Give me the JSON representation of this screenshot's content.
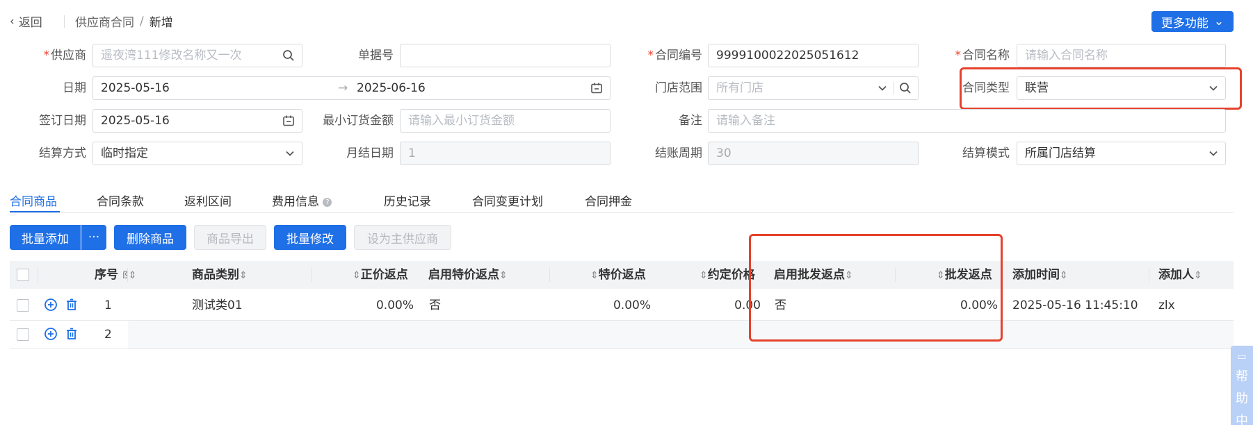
{
  "header": {
    "back_label": "返回",
    "breadcrumb_parent": "供应商合同",
    "breadcrumb_sep": "/",
    "breadcrumb_current": "新增",
    "more_button": "更多功能"
  },
  "form": {
    "supplier": {
      "label": "供应商",
      "value": "遥夜湾111修改名称又一次"
    },
    "doc_no": {
      "label": "单据号",
      "value": ""
    },
    "contract_no": {
      "label": "合同编号",
      "value": "9999100022025051612"
    },
    "contract_name": {
      "label": "合同名称",
      "placeholder": "请输入合同名称"
    },
    "date": {
      "label": "日期",
      "start": "2025-05-16",
      "arrow": "→",
      "end": "2025-06-16"
    },
    "store_scope": {
      "label": "门店范围",
      "placeholder": "所有门店"
    },
    "contract_type": {
      "label": "合同类型",
      "value": "联营"
    },
    "sign_date": {
      "label": "签订日期",
      "value": "2025-05-16"
    },
    "min_order": {
      "label": "最小订货金额",
      "placeholder": "请输入最小订货金额"
    },
    "remark": {
      "label": "备注",
      "placeholder": "请输入备注"
    },
    "settle_method": {
      "label": "结算方式",
      "value": "临时指定"
    },
    "monthly_day": {
      "label": "月结日期",
      "value": "1"
    },
    "billing_cycle": {
      "label": "结账周期",
      "value": "30"
    },
    "settle_mode": {
      "label": "结算模式",
      "value": "所属门店结算"
    }
  },
  "tabs": [
    {
      "label": "合同商品"
    },
    {
      "label": "合同条款"
    },
    {
      "label": "返利区间"
    },
    {
      "label": "费用信息"
    },
    {
      "label": "历史记录"
    },
    {
      "label": "合同变更计划"
    },
    {
      "label": "合同押金"
    }
  ],
  "toolbar": {
    "batch_add": "批量添加",
    "batch_add_more": "···",
    "delete_goods": "删除商品",
    "export_goods": "商品导出",
    "batch_edit": "批量修改",
    "set_main_supplier": "设为主供应商"
  },
  "table": {
    "headers": {
      "seq": "序号",
      "category": "商品类别",
      "normal_rebate": "正价返点",
      "enable_special": "启用特价返点",
      "special_rebate": "特价返点",
      "agreed_price": "约定价格",
      "enable_wholesale": "启用批发返点",
      "wholesale_rebate": "批发返点",
      "add_time": "添加时间",
      "adder": "添加人"
    },
    "rows": [
      {
        "seq": "1",
        "category": "测试类01",
        "normal_rebate": "0.00%",
        "enable_special": "否",
        "special_rebate": "0.00%",
        "agreed_price": "0.00",
        "enable_wholesale": "否",
        "wholesale_rebate": "0.00%",
        "add_time": "2025-05-16 11:45:10",
        "adder": "zlx"
      },
      {
        "seq": "2",
        "category": "",
        "normal_rebate": "",
        "enable_special": "",
        "special_rebate": "",
        "agreed_price": "",
        "enable_wholesale": "",
        "wholesale_rebate": "",
        "add_time": "",
        "adder": ""
      }
    ]
  },
  "help": {
    "chars": [
      "帮",
      "助",
      "中"
    ]
  },
  "colors": {
    "primary": "#1f6fe6",
    "highlight_border": "#e5412d",
    "required": "#e43"
  }
}
